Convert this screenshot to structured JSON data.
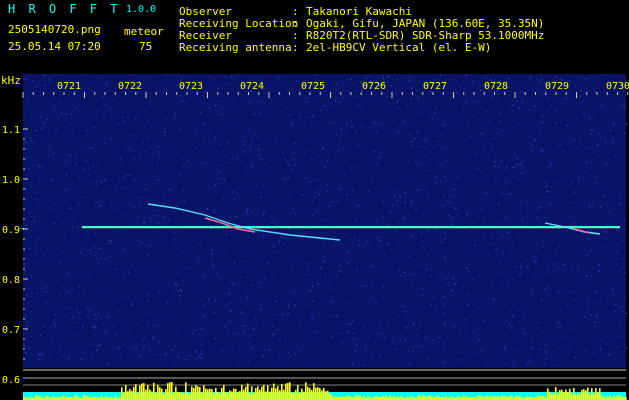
{
  "header": {
    "app_name": "H R O F F T",
    "version": "1.0.0",
    "filename": "2505140720.png",
    "datetime": "25.05.14 07:20",
    "mode_label": "meteor",
    "meteor_count": "75",
    "fields": [
      {
        "label": "Observer",
        "sep": ":",
        "value": "Takanori Kawachi"
      },
      {
        "label": "Receiving Location",
        "sep": ":",
        "value": "Ogaki, Gifu, JAPAN (136.60E, 35.35N)"
      },
      {
        "label": "Receiver",
        "sep": ":",
        "value": "R820T2(RTL-SDR) SDR-Sharp 53.1000MHz"
      },
      {
        "label": "Receiving antenna",
        "sep": ":",
        "value": "2el-HB9CV Vertical (el. E-W)"
      }
    ]
  },
  "axis": {
    "y_unit": "kHz",
    "y_ticks": [
      "1.1",
      "1.0",
      "0.9",
      "0.8",
      "0.7",
      "0.6"
    ],
    "time_ticks": [
      "0721",
      "0722",
      "0723",
      "0724",
      "0725",
      "0726",
      "0727",
      "0728",
      "0729",
      "0730"
    ]
  },
  "colors": {
    "background": "#000000",
    "spectrum_bg": "#0a1466",
    "carrier": "#33ffcc",
    "axis_text": "#ffff00",
    "header_cyan": "#00ffff",
    "level_bars": "#ffff00",
    "level_base": "#00ffff"
  }
}
